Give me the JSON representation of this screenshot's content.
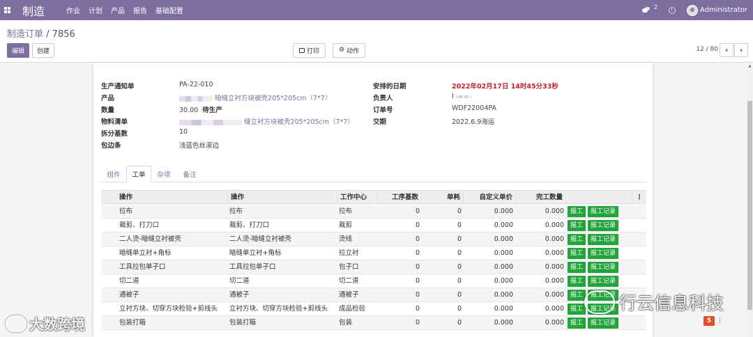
{
  "navbar": {
    "brand": "制造",
    "menu": [
      "作业",
      "计划",
      "产品",
      "报告",
      "基础配置"
    ],
    "chat_count": "2",
    "user": "Administrator"
  },
  "control": {
    "breadcrumb_parent": "制造订单",
    "breadcrumb_sep": " / ",
    "breadcrumb_current": "7856",
    "edit_label": "编辑",
    "create_label": "创建",
    "print_label": "打印",
    "action_label": "动作",
    "pager": "12 / 80"
  },
  "form": {
    "left": [
      {
        "label": "生产通知单",
        "value": "PA-22-010"
      },
      {
        "label": "产品",
        "value": "暗缝立衬方块被壳205*205cm（7*7）"
      },
      {
        "label": "数量",
        "value": "30.00",
        "extra": "待生产"
      },
      {
        "label": "物料清单",
        "value": "缝立衬方块被壳205*205cm（7*7）"
      },
      {
        "label": "拆分基数",
        "value": "10"
      },
      {
        "label": "包边条",
        "value": "浅蓝色丝滚边"
      }
    ],
    "right": [
      {
        "label": "安排的日期",
        "value": "2022年02月17日 14时45分33秒"
      },
      {
        "label": "负责人",
        "value": "I"
      },
      {
        "label": "订单号",
        "value": "WDF22004PA"
      },
      {
        "label": "交期",
        "value": "2022.6.9海运"
      }
    ]
  },
  "tabs": [
    "组件",
    "工单",
    "杂项",
    "备注"
  ],
  "table": {
    "headers": [
      "操作",
      "操作",
      "工作中心",
      "工序基数",
      "单耗",
      "自定义单价",
      "完工数量"
    ],
    "report_label": "报工",
    "record_label": "报工记录",
    "rows": [
      {
        "op": "拉布",
        "op2": "拉布",
        "wc": "拉布",
        "base": "0",
        "unit": "0",
        "price": "0.000",
        "qty": "0.000"
      },
      {
        "op": "裁剪、打刀口",
        "op2": "裁剪、打刀口",
        "wc": "裁剪",
        "base": "0",
        "unit": "0",
        "price": "0.000",
        "qty": "0.000"
      },
      {
        "op": "二人烫-暗缝立衬被壳",
        "op2": "二人烫-暗缝立衬被壳",
        "wc": "烫线",
        "base": "0",
        "unit": "0",
        "price": "0.000",
        "qty": "0.000"
      },
      {
        "op": "暗缝单立衬+角标",
        "op2": "暗缝单立衬+角标",
        "wc": "拉立衬",
        "base": "0",
        "unit": "0",
        "price": "0.000",
        "qty": "0.000"
      },
      {
        "op": "工具拉包单子口",
        "op2": "工具拉包单子口",
        "wc": "包子口",
        "base": "0",
        "unit": "0",
        "price": "0.000",
        "qty": "0.000"
      },
      {
        "op": "切二道",
        "op2": "切二道",
        "wc": "切二道",
        "base": "0",
        "unit": "0",
        "price": "0.000",
        "qty": "0.000"
      },
      {
        "op": "通被子",
        "op2": "通被子",
        "wc": "通被子",
        "base": "0",
        "unit": "0",
        "price": "0.000",
        "qty": "0.000"
      },
      {
        "op": "立衬方块、切穿方块检验+剪线头",
        "op2": "立衬方块、切穿方块检验+剪线头",
        "wc": "成品检验",
        "base": "0",
        "unit": "0",
        "price": "0.000",
        "qty": "0.000"
      },
      {
        "op": "包装打箱",
        "op2": "包装打箱",
        "wc": "包装",
        "base": "0",
        "unit": "0",
        "price": "0.000",
        "qty": "0.000"
      }
    ]
  },
  "watermarks": {
    "left": "大数跨境",
    "right": "行云信息科技",
    "badge": "5"
  },
  "colors": {
    "navbar": "#7c6e9e",
    "green_button": "#21a43a",
    "red_date": "#c0262d"
  }
}
